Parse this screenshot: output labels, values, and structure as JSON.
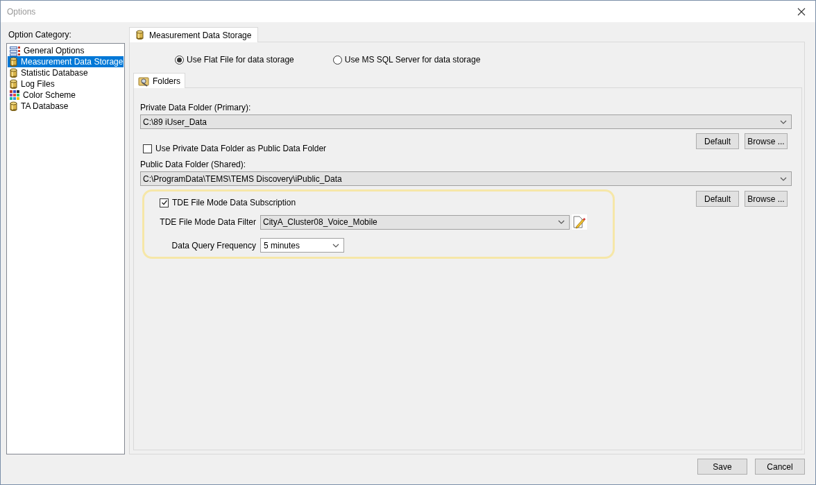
{
  "window": {
    "title": "Options"
  },
  "sidebar": {
    "label": "Option Category:",
    "items": [
      {
        "label": "General Options",
        "kind": "list",
        "selected": false
      },
      {
        "label": "Measurement Data Storage",
        "kind": "database",
        "selected": true
      },
      {
        "label": "Statistic Database",
        "kind": "database",
        "selected": false
      },
      {
        "label": "Log Files",
        "kind": "database",
        "selected": false
      },
      {
        "label": "Color Scheme",
        "kind": "palette",
        "selected": false
      },
      {
        "label": "TA Database",
        "kind": "database",
        "selected": false
      }
    ]
  },
  "tabs": [
    {
      "label": "Measurement Data Storage",
      "selected": true
    }
  ],
  "storage_options": [
    {
      "label": "Use Flat File for data storage",
      "selected": true
    },
    {
      "label": "Use MS SQL Server for data storage",
      "selected": false
    }
  ],
  "subtabs": [
    {
      "label": "Folders",
      "selected": true
    }
  ],
  "private_folder": {
    "label": "Private Data Folder (Primary):",
    "value": "C:\\89 iUser_Data",
    "buttons": [
      "Default",
      "Browse ..."
    ]
  },
  "use_private_as_public": {
    "label": "Use Private Data Folder as Public Data Folder",
    "checked": false
  },
  "public_folder": {
    "label": "Public Data Folder (Shared):",
    "value": "C:\\ProgramData\\TEMS\\TEMS Discovery\\iPublic_Data",
    "buttons": [
      "Default",
      "Browse ..."
    ]
  },
  "subscription": {
    "label": "TDE File Mode Data Subscription",
    "checked": true,
    "filter": {
      "label": "TDE File Mode Data Filter",
      "value": "CityA_Cluster08_Voice_Mobile"
    },
    "frequency": {
      "label": "Data Query Frequency",
      "value": "5 minutes"
    }
  },
  "footer_buttons": [
    "Save",
    "Cancel"
  ]
}
